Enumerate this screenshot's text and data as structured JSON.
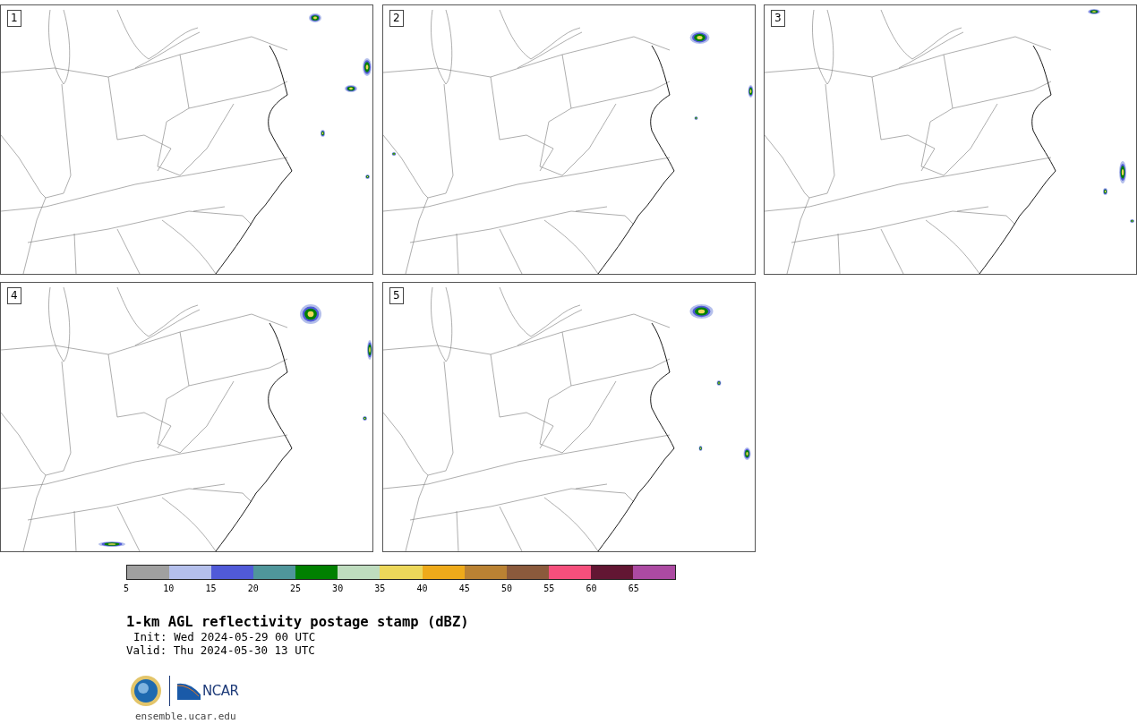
{
  "panels": [
    {
      "label": "1"
    },
    {
      "label": "2"
    },
    {
      "label": "3"
    },
    {
      "label": "4"
    },
    {
      "label": "5"
    }
  ],
  "colorbar": {
    "segments": [
      {
        "color": "#a0a0a0"
      },
      {
        "color": "#b4bfeb"
      },
      {
        "color": "#505ad8"
      },
      {
        "color": "#4f969b"
      },
      {
        "color": "#008000"
      },
      {
        "color": "#bedcbe"
      },
      {
        "color": "#ecd75a"
      },
      {
        "color": "#eeaa1a"
      },
      {
        "color": "#ba8233"
      },
      {
        "color": "#8b5a3c"
      },
      {
        "color": "#f54f7c"
      },
      {
        "color": "#621633"
      },
      {
        "color": "#ac4aa2"
      }
    ],
    "ticks": [
      "5",
      "10",
      "15",
      "20",
      "25",
      "30",
      "35",
      "40",
      "45",
      "50",
      "55",
      "60",
      "65"
    ]
  },
  "title": "1-km AGL reflectivity postage stamp (dBZ)",
  "init": "Init: Wed 2024-05-29 00 UTC",
  "valid": "Valid: Thu 2024-05-30 13 UTC",
  "logo": {
    "text": "NCAR"
  },
  "footer": "ensemble.ucar.edu"
}
